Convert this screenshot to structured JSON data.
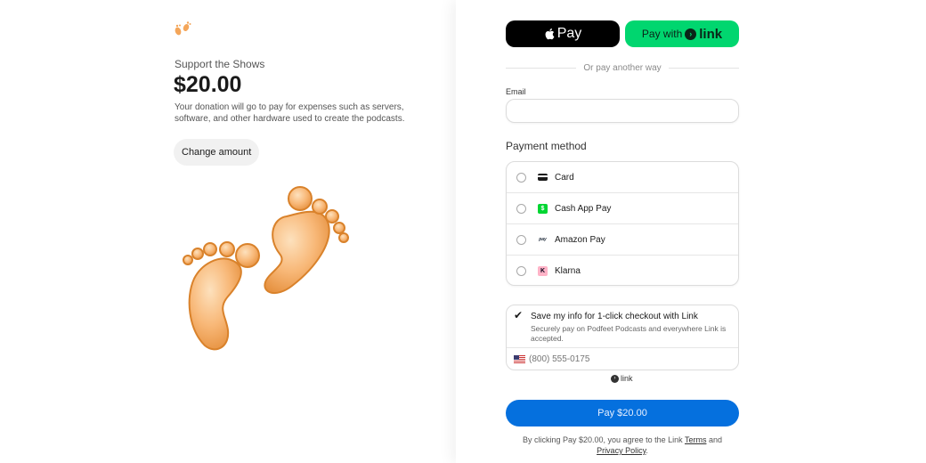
{
  "merchant": {
    "name": "Support the Shows",
    "amount": "$20.00",
    "description": "Your donation will go to pay for expenses such as servers, software, and other hardware used to create the podcasts.",
    "change_amount_label": "Change amount"
  },
  "wallets": {
    "apple_pay_label": "Pay",
    "link_prefix": "Pay with",
    "link_word": "link"
  },
  "divider_text": "Or pay another way",
  "email": {
    "label": "Email",
    "value": "",
    "placeholder": ""
  },
  "payment_method": {
    "title": "Payment method",
    "options": [
      {
        "label": "Card",
        "icon": "card-icon"
      },
      {
        "label": "Cash App Pay",
        "icon": "cash-app-icon"
      },
      {
        "label": "Amazon Pay",
        "icon": "amazon-pay-icon"
      },
      {
        "label": "Klarna",
        "icon": "klarna-icon"
      }
    ]
  },
  "save_info": {
    "title": "Save my info for 1-click checkout with Link",
    "subtitle": "Securely pay on Podfeet Podcasts and everywhere Link is accepted.",
    "phone_placeholder": "(800) 555-0175",
    "checked": true
  },
  "link_badge": "link",
  "pay_button": "Pay $20.00",
  "legal": {
    "prefix": "By clicking Pay $20.00, you agree to the Link",
    "terms": "Terms",
    "and": "and",
    "privacy": "Privacy Policy",
    "suffix": "."
  },
  "colors": {
    "link_green": "#00d66f",
    "pay_blue": "#0570de",
    "apple_black": "#000000",
    "feet_orange": "#f6b26b"
  }
}
